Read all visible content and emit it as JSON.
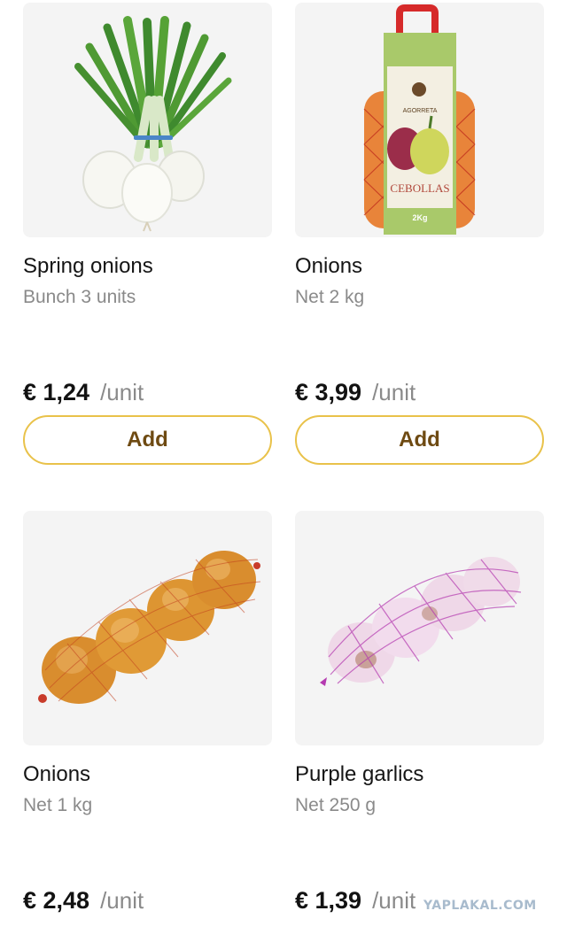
{
  "products": [
    {
      "name": "Spring onions",
      "detail": "Bunch 3 units",
      "price": "€ 1,24",
      "unit": "/unit",
      "add_label": "Add",
      "image": "spring-onions-image"
    },
    {
      "name": "Onions",
      "detail": "Net 2 kg",
      "price": "€ 3,99",
      "unit": "/unit",
      "add_label": "Add",
      "image": "onion-bag-image",
      "package_brand": "AGORRETA",
      "package_label": "CEBOLLAS",
      "package_weight": "2Kg"
    },
    {
      "name": "Onions",
      "detail": "Net 1 kg",
      "price": "€ 2,48",
      "unit": "/unit",
      "image": "onion-net-image"
    },
    {
      "name": "Purple garlics",
      "detail": "Net 250 g",
      "price": "€ 1,39",
      "unit": "/unit",
      "image": "garlic-net-image"
    }
  ],
  "watermark": "YAPLAKAL.COM",
  "colors": {
    "button_border": "#e9c24a",
    "button_text": "#6e4a12",
    "thumb_bg": "#f4f4f4",
    "muted_text": "#8a8a8a"
  }
}
